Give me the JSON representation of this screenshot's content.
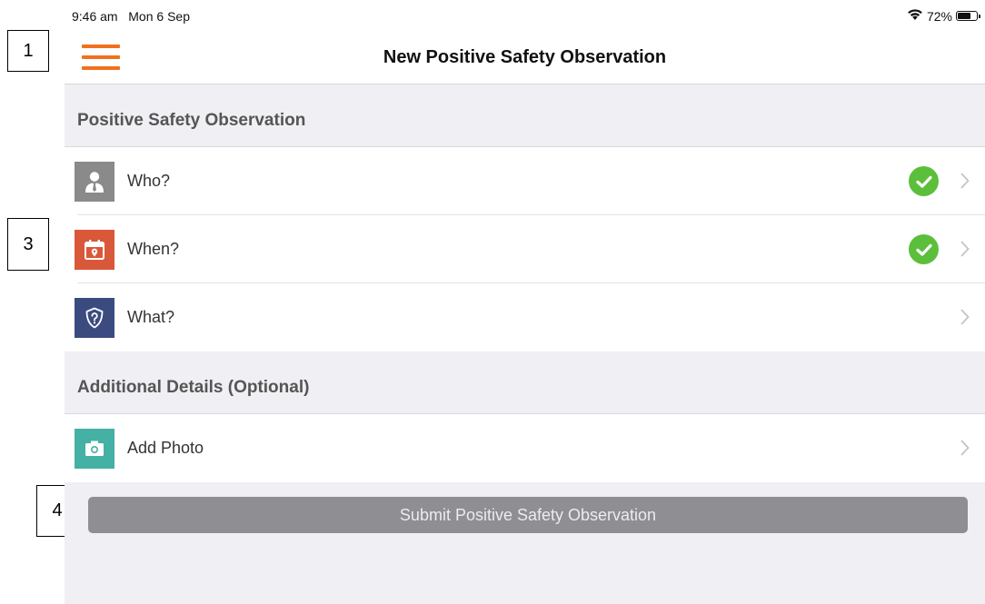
{
  "callouts": [
    {
      "label": "1"
    },
    {
      "label": "3"
    },
    {
      "label": "4"
    }
  ],
  "status_bar": {
    "time": "9:46 am",
    "date": "Mon 6 Sep",
    "wifi_icon": "wifi-icon",
    "battery_level": "72%",
    "battery_fraction": 0.72
  },
  "navbar": {
    "menu_icon": "hamburger-menu-icon",
    "title": "New Positive Safety Observation"
  },
  "sections": [
    {
      "header": "Positive Safety Observation",
      "rows": [
        {
          "label": "Who?",
          "icon": "person-icon",
          "icon_bg": "#8a8a8a",
          "completed": true
        },
        {
          "label": "When?",
          "icon": "calendar-icon",
          "icon_bg": "#d9583a",
          "completed": true
        },
        {
          "label": "What?",
          "icon": "shield-question-icon",
          "icon_bg": "#3b4b80",
          "completed": false
        }
      ]
    },
    {
      "header": "Additional Details (Optional)",
      "rows": [
        {
          "label": "Add Photo",
          "icon": "camera-icon",
          "icon_bg": "#45b0a4",
          "completed": false
        }
      ]
    }
  ],
  "submit_button": {
    "label": "Submit Positive Safety Observation",
    "color": "#8e8e93"
  },
  "colors": {
    "accent": "#f2701c",
    "check_green": "#5cbf3b",
    "group_bg": "#efeff4"
  }
}
